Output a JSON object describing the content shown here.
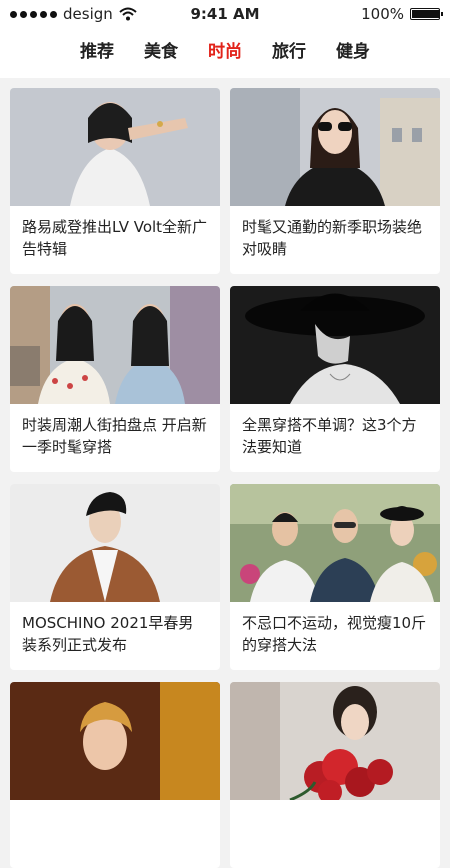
{
  "status_bar": {
    "carrier": "design",
    "time": "9:41 AM",
    "battery": "100%",
    "battery_level": 1.0,
    "icons": [
      "signal-icon",
      "wifi-icon",
      "battery-icon"
    ]
  },
  "tabs": [
    {
      "label": "推荐",
      "active": false
    },
    {
      "label": "美食",
      "active": false
    },
    {
      "label": "时尚",
      "active": true
    },
    {
      "label": "旅行",
      "active": false
    },
    {
      "label": "健身",
      "active": false
    }
  ],
  "colors": {
    "accent": "#e2231a",
    "background": "#f2f2f2",
    "card": "#ffffff"
  },
  "articles": [
    {
      "title": "路易威登推出LV Volt全新广告特辑"
    },
    {
      "title": "时髦又通勤的新季职场装绝对吸睛"
    },
    {
      "title": "时装周潮人街拍盘点 开启新一季时髦穿搭"
    },
    {
      "title": "全黑穿搭不单调？这3个方法要知道"
    },
    {
      "title": "MOSCHINO 2021早春男装系列正式发布"
    },
    {
      "title": "不忌口不运动，视觉瘦10斤的穿搭大法"
    },
    {
      "title": ""
    },
    {
      "title": ""
    }
  ]
}
